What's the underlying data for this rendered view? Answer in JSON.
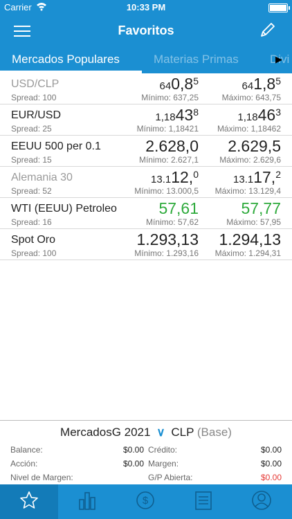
{
  "status_bar": {
    "carrier": "Carrier",
    "time": "10:33 PM"
  },
  "nav": {
    "title": "Favoritos"
  },
  "tabs": [
    "Mercados Populares",
    "Materias Primas",
    "Divi"
  ],
  "markets": [
    {
      "name": "USD/CLP",
      "spread": "Spread: 100",
      "bid_small": "64",
      "bid_big": "0,8",
      "bid_sup": "5",
      "ask_small": "64",
      "ask_big": "1,8",
      "ask_sup": "5",
      "min": "Mínimo: 637,25",
      "max": "Máximo: 643,75"
    },
    {
      "name": "EUR/USD",
      "spread": "Spread: 25",
      "bid_small": "1,18",
      "bid_big": "43",
      "bid_sup": "8",
      "ask_small": "1,18",
      "ask_big": "46",
      "ask_sup": "3",
      "min": "Mínimo: 1,18421",
      "max": "Máximo: 1,18462"
    },
    {
      "name": "EEUU 500 per 0.1",
      "spread": "Spread: 15",
      "bid_full": "2.628,0",
      "ask_full": "2.629,5",
      "min": "Mínimo: 2.627,1",
      "max": "Máximo: 2.629,6"
    },
    {
      "name": "Alemania 30",
      "spread": "Spread: 52",
      "bid_small": "13.1",
      "bid_big": "12,",
      "bid_sup": "0",
      "ask_small": "13.1",
      "ask_big": "17,",
      "ask_sup": "2",
      "min": "Mínimo: 13.000,5",
      "max": "Máximo: 13.129,4"
    },
    {
      "name": "WTI (EEUU) Petroleo",
      "spread": "Spread: 16",
      "bid_full": "57,61",
      "ask_full": "57,77",
      "min": "Mínimo: 57,62",
      "max": "Máximo: 57,95"
    },
    {
      "name": "Spot Oro",
      "spread": "Spread: 100",
      "bid_full": "1.293,13",
      "ask_full": "1.294,13",
      "min": "Mínimo: 1.293,16",
      "max": "Máximo: 1.294,31"
    }
  ],
  "account": {
    "name": "MercadosG 2021",
    "currency": "CLP",
    "base": "(Base)",
    "balance_label": "Balance:",
    "balance": "$0.00",
    "credit_label": "Crédito:",
    "credit": "$0.00",
    "action_label": "Acción:",
    "action": "$0.00",
    "margin_label": "Margen:",
    "margin": "$0.00",
    "margin_level_label": "Nivel de Margen:",
    "margin_level": "",
    "open_pl_label": "G/P Abierta:",
    "open_pl": "$0.00"
  },
  "colors": {
    "primary": "#1b8fd2",
    "up": "#2eaa3c",
    "down": "#e53935"
  },
  "tabbar": [
    "star-icon",
    "bar-chart-icon",
    "dollar-cycle-icon",
    "list-icon",
    "user-icon"
  ]
}
